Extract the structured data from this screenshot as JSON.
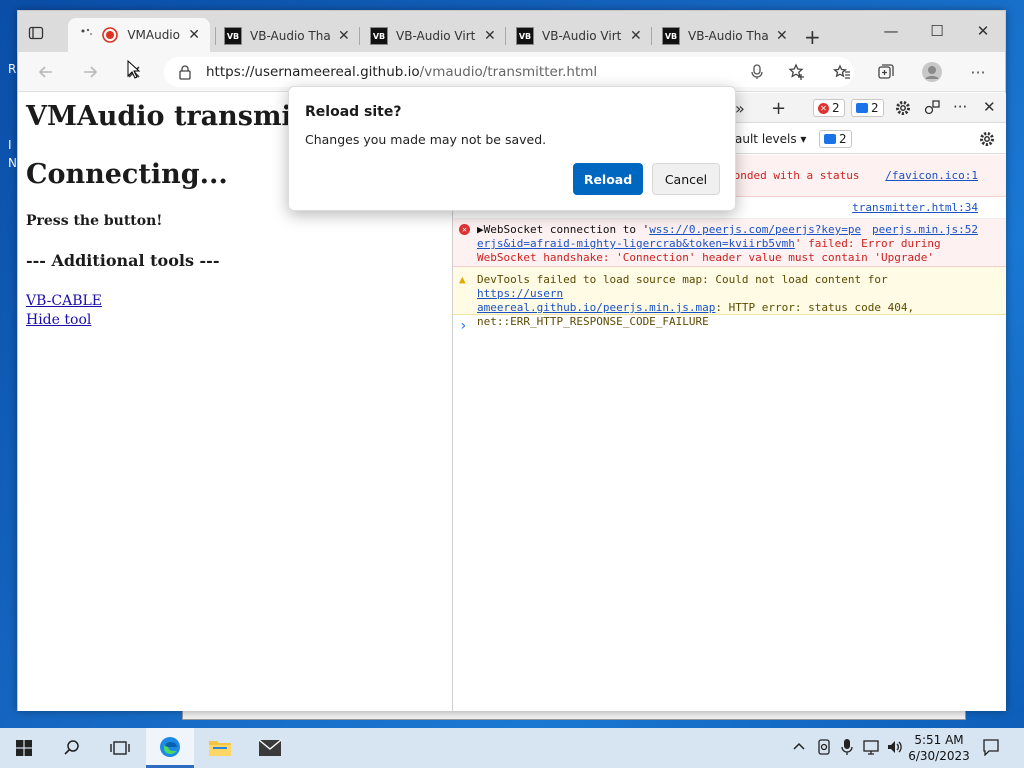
{
  "desktop": {
    "side_text": "R\nI\nN"
  },
  "browser": {
    "tabs": [
      {
        "label": "VMAudio",
        "favicon": "record-icon",
        "active": true
      },
      {
        "label": "VB-Audio Than",
        "favicon": "VB"
      },
      {
        "label": "VB-Audio Virtu",
        "favicon": "VB"
      },
      {
        "label": "VB-Audio Virtu",
        "favicon": "VB"
      },
      {
        "label": "VB-Audio Than",
        "favicon": "VB"
      }
    ],
    "url_host": "https://usernameereal.github.io",
    "url_path": "/vmaudio/transmitter.html"
  },
  "page": {
    "title": "VMAudio transmit",
    "status": "Connecting...",
    "instruction": "Press the button!",
    "tools_heading": "--- Additional tools ---",
    "links": [
      "VB-CABLE",
      "Hide tool"
    ]
  },
  "devtools": {
    "error_count": "2",
    "message_count": "2",
    "levels_label": "ault levels ▾",
    "filter_count": "2",
    "rows": [
      {
        "text": "ponded with a status",
        "source": "/favicon.ico:1"
      },
      {
        "text": "",
        "source": "transmitter.html:34"
      },
      {
        "prefix": "▶WebSocket connection to '",
        "link": "wss://0.peerjs.com/peerjs?key=pe",
        "source": "peerjs.min.js:52",
        "line2_link": "erjs&id=afraid-mighty-ligercrab&token=kviirb5vmh",
        "line2_rest": "' failed: Error during",
        "line3": "WebSocket handshake: 'Connection' header value must contain 'Upgrade'"
      },
      {
        "prefix": "DevTools failed to load source map: Could not load content for ",
        "link": "https://usern",
        "line2_link": "ameereal.github.io/peerjs.min.js.map",
        "line2_rest": ": HTTP error: status code 404,",
        "line3": "net::ERR_HTTP_RESPONSE_CODE_FAILURE"
      }
    ],
    "prompt": "›"
  },
  "dialog": {
    "title": "Reload site?",
    "message": "Changes you made may not be saved.",
    "reload": "Reload",
    "cancel": "Cancel"
  },
  "taskbar": {
    "time": "5:51 AM",
    "date": "6/30/2023"
  },
  "colors": {
    "accent": "#0067c0",
    "error": "#d33333",
    "taskbar": "#d7e4f2"
  }
}
